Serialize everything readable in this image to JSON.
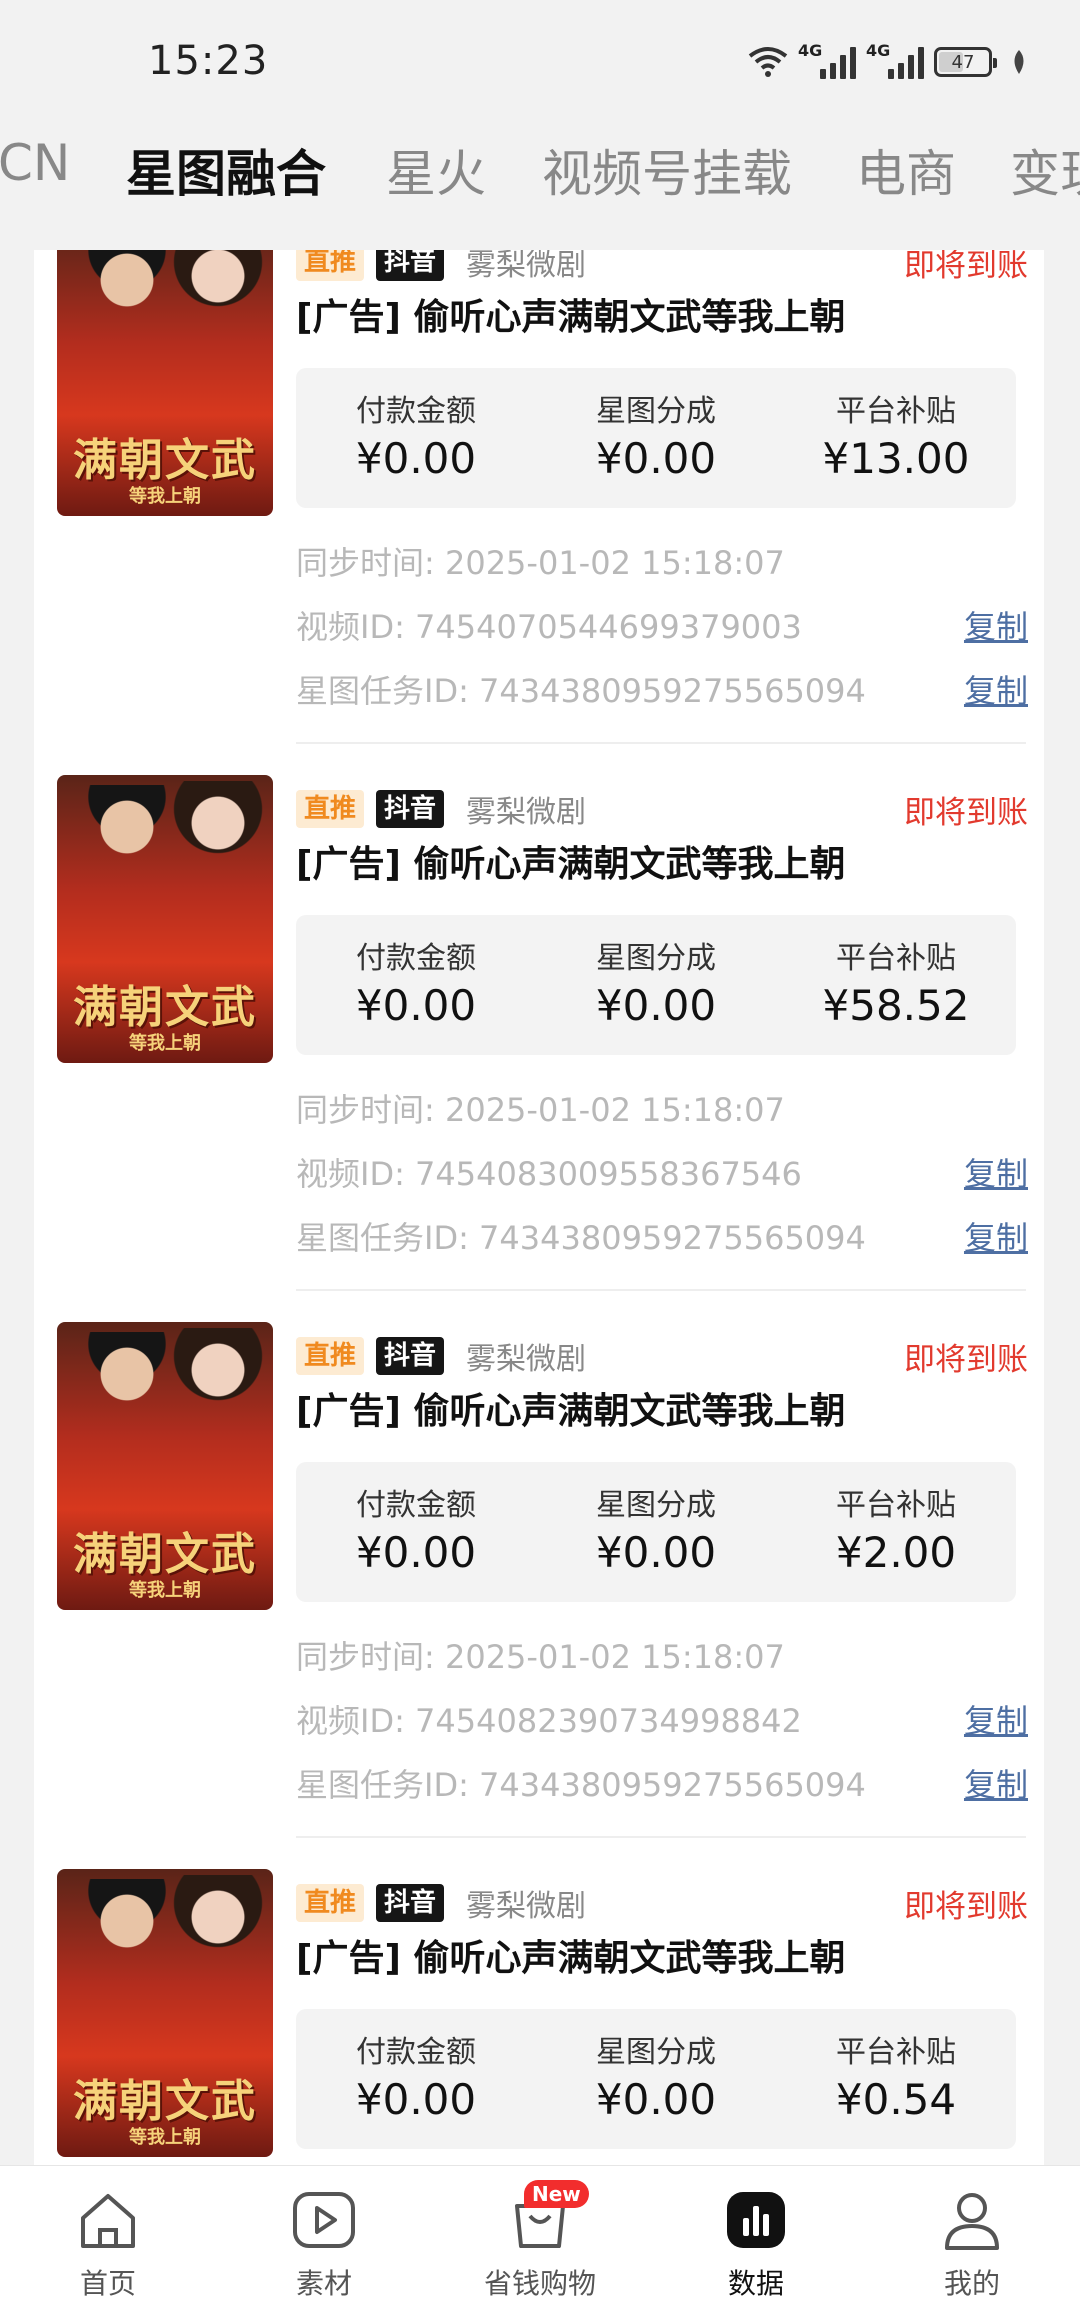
{
  "status_bar": {
    "time": "15:23",
    "net1": "4G",
    "net2": "4G",
    "battery": "47"
  },
  "tabs": [
    "CN",
    "星图融合",
    "星火",
    "视频号挂载",
    "电商",
    "变现"
  ],
  "active_tab": 1,
  "labels": {
    "tag_zt": "直推",
    "tag_dy": "抖音",
    "source": "雾梨微剧",
    "status": "即将到账",
    "title": "[广告] 偷听心声满朝文武等我上朝",
    "col_pay": "付款金额",
    "col_share": "星图分成",
    "col_subsidy": "平台补贴",
    "sync_prefix": "同步时间:",
    "video_prefix": "视频ID:",
    "task_prefix": "星图任务ID:",
    "copy": "复制",
    "poster_title": "满朝文武",
    "poster_sub": "等我上朝"
  },
  "items": [
    {
      "pay": "¥0.00",
      "share": "¥0.00",
      "subsidy": "¥13.00",
      "sync_time": "2025-01-02 15:18:07",
      "video_id": "7454070544699379003",
      "task_id": "7434380959275565094"
    },
    {
      "pay": "¥0.00",
      "share": "¥0.00",
      "subsidy": "¥58.52",
      "sync_time": "2025-01-02 15:18:07",
      "video_id": "7454083009558367546",
      "task_id": "7434380959275565094"
    },
    {
      "pay": "¥0.00",
      "share": "¥0.00",
      "subsidy": "¥2.00",
      "sync_time": "2025-01-02 15:18:07",
      "video_id": "7454082390734998842",
      "task_id": "7434380959275565094"
    },
    {
      "pay": "¥0.00",
      "share": "¥0.00",
      "subsidy": "¥0.54"
    }
  ],
  "bottom_nav": [
    {
      "label": "首页",
      "icon": "home-icon"
    },
    {
      "label": "素材",
      "icon": "play-icon"
    },
    {
      "label": "省钱购物",
      "icon": "shopping-bag-icon",
      "badge": "New"
    },
    {
      "label": "数据",
      "icon": "bar-chart-icon",
      "active": true
    },
    {
      "label": "我的",
      "icon": "user-icon"
    }
  ]
}
